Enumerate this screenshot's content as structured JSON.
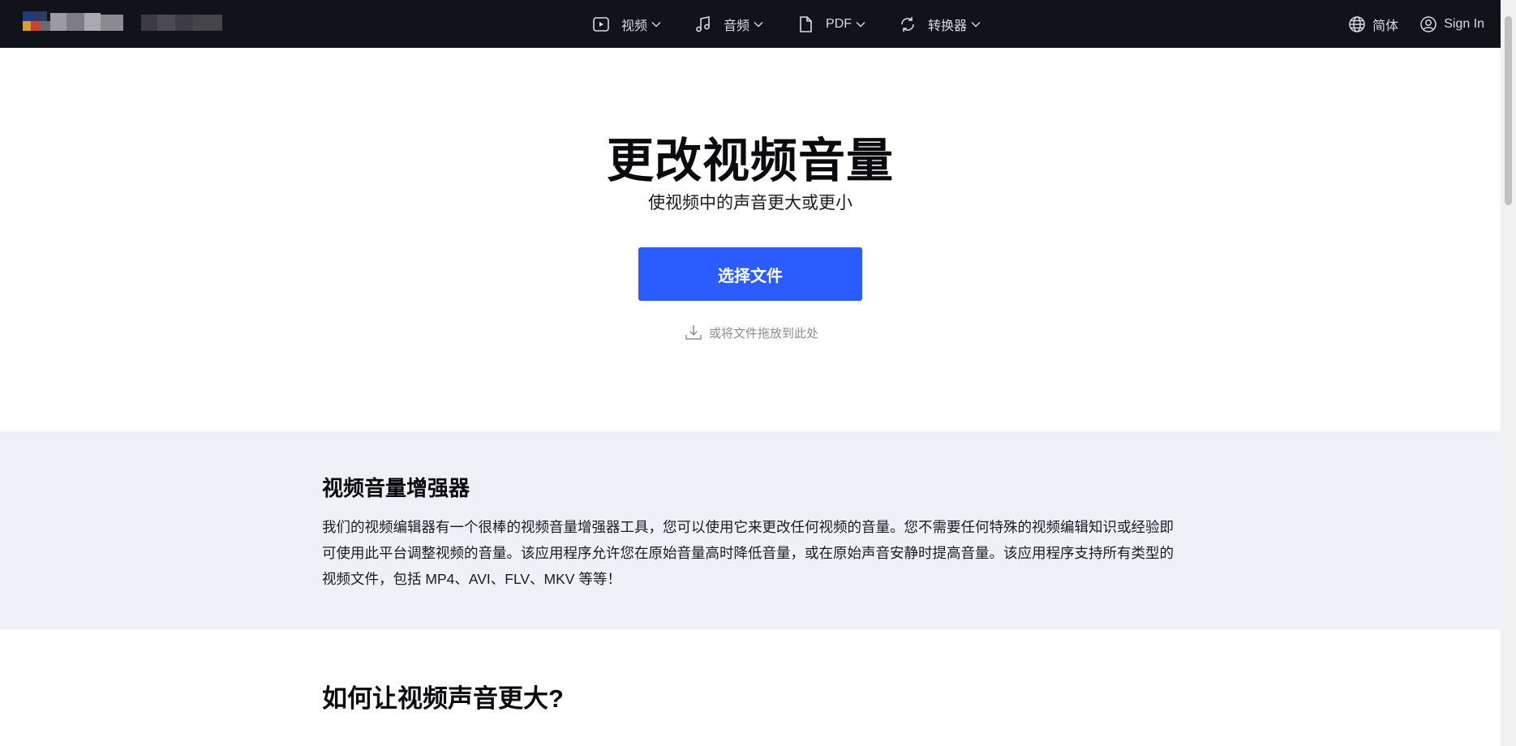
{
  "nav": {
    "items": [
      {
        "label": "视频",
        "icon": "video-play-icon"
      },
      {
        "label": "音频",
        "icon": "music-note-icon"
      },
      {
        "label": "PDF",
        "icon": "document-icon"
      },
      {
        "label": "转换器",
        "icon": "convert-icon"
      }
    ],
    "language_label": "简体",
    "signin_label": "Sign In"
  },
  "hero": {
    "title": "更改视频音量",
    "subtitle": "使视频中的声音更大或更小",
    "choose_button": "选择文件",
    "drop_hint": "或将文件拖放到此处"
  },
  "info": {
    "title": "视频音量增强器",
    "body": "我们的视频编辑器有一个很棒的视频音量增强器工具，您可以使用它来更改任何视频的音量。您不需要任何特殊的视频编辑知识或经验即可使用此平台调整视频的音量。该应用程序允许您在原始音量高时降低音量，或在原始声音安静时提高音量。该应用程序支持所有类型的视频文件，包括 MP4、AVI、FLV、MKV 等等！"
  },
  "how": {
    "title": "如何让视频声音更大?"
  },
  "colors": {
    "topbar": "#12131a",
    "accent": "#2b5cff",
    "section_bg": "#eef1f5"
  }
}
